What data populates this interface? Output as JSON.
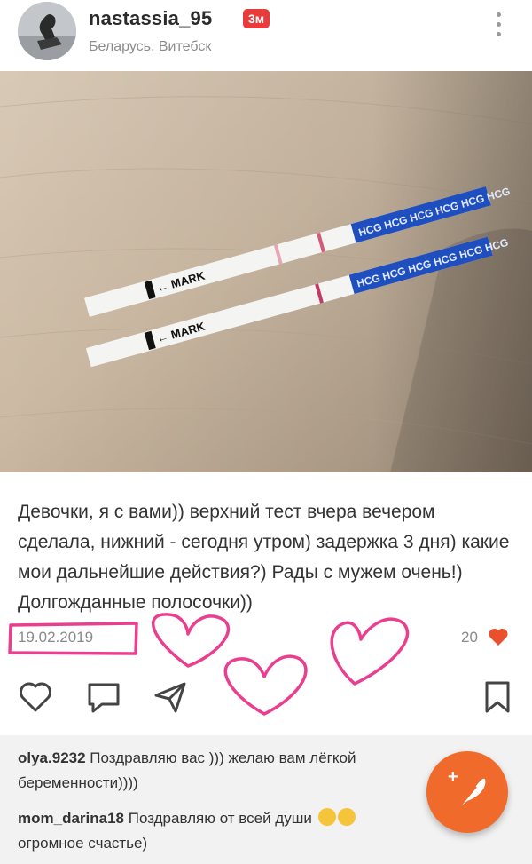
{
  "post": {
    "username": "nastassia_95",
    "time_badge": "3м",
    "location": "Беларусь, Витебск",
    "caption": "Девочки, я с вами)) верхний тест вчера вечером сделала, нижний - сегодня утром) задержка 3 дня) какие мои дальнейшие действия?) Рады с мужем очень!) Долгожданные полосочки))",
    "date": "19.02.2019",
    "likes": "20"
  },
  "photo": {
    "strip_mark_text": "MARK",
    "strip_brand_text": "HCG HCG HCG HCG HCG HCG"
  },
  "icons": {
    "more": "more-vertical-icon",
    "like": "heart-outline-icon",
    "comment": "speech-bubble-icon",
    "share": "paper-plane-icon",
    "bookmark": "bookmark-icon",
    "fab": "feather-pen-icon"
  },
  "colors": {
    "badge": "#ea3b3b",
    "fab": "#f06b2b",
    "heart": "#e8502e",
    "doodle": "#ea3f8f"
  },
  "comments": [
    {
      "author": "olya.9232",
      "text": " Поздравляю вас ))) желаю вам лёгкой",
      "text2": "беременности))))"
    },
    {
      "author": "mom_darina18",
      "text": " Поздравляю от всей души ",
      "text2": "огромное счастье)"
    }
  ]
}
